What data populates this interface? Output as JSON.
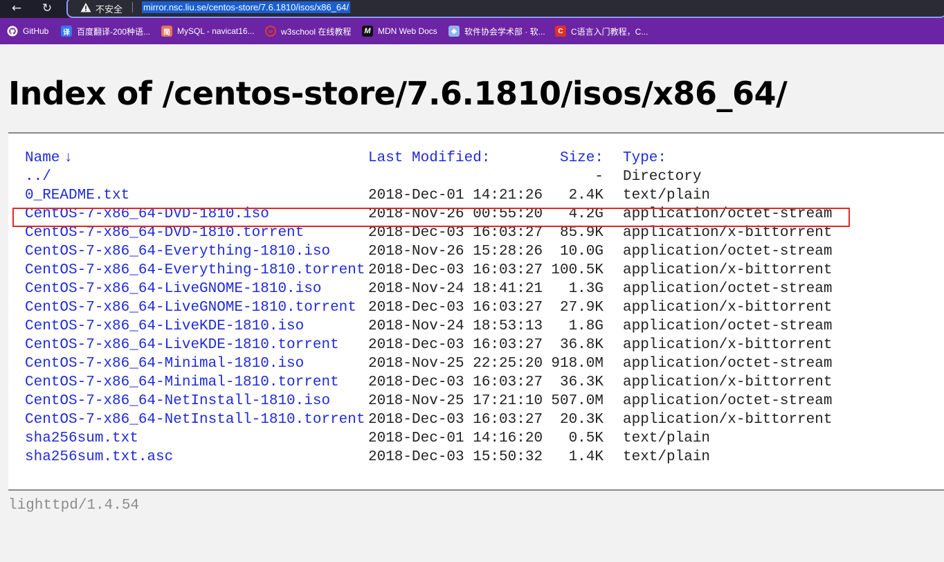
{
  "browser": {
    "security_label": "不安全",
    "url": "mirror.nsc.liu.se/centos-store/7.6.1810/isos/x86_64/",
    "bookmarks": [
      {
        "label": "GitHub",
        "icon": "github-icon"
      },
      {
        "label": "百度翻译-200种语...",
        "icon": "translate-icon"
      },
      {
        "label": "MySQL - navicat16...",
        "icon": "jianshu-icon"
      },
      {
        "label": "w3school 在线教程",
        "icon": "w3school-icon"
      },
      {
        "label": "MDN Web Docs",
        "icon": "mdn-icon"
      },
      {
        "label": "软件协会学术部 · 软...",
        "icon": "bookmark-icon"
      },
      {
        "label": "C语言入门教程，C...",
        "icon": "csdn-icon"
      }
    ]
  },
  "page": {
    "title": "Index of /centos-store/7.6.1810/isos/x86_64/",
    "headers": {
      "name": "Name",
      "sort_arrow": "↓",
      "modified": "Last Modified:",
      "size": "Size:",
      "type": "Type:"
    },
    "rows": [
      {
        "name": "../",
        "modified": "",
        "size": "-",
        "type": "Directory"
      },
      {
        "name": "0_README.txt",
        "modified": "2018-Dec-01 14:21:26",
        "size": "2.4K",
        "type": "text/plain"
      },
      {
        "name": "CentOS-7-x86_64-DVD-1810.iso",
        "modified": "2018-Nov-26 00:55:20",
        "size": "4.2G",
        "type": "application/octet-stream"
      },
      {
        "name": "CentOS-7-x86_64-DVD-1810.torrent",
        "modified": "2018-Dec-03 16:03:27",
        "size": "85.9K",
        "type": "application/x-bittorrent"
      },
      {
        "name": "CentOS-7-x86_64-Everything-1810.iso",
        "modified": "2018-Nov-26 15:28:26",
        "size": "10.0G",
        "type": "application/octet-stream"
      },
      {
        "name": "CentOS-7-x86_64-Everything-1810.torrent",
        "modified": "2018-Dec-03 16:03:27",
        "size": "100.5K",
        "type": "application/x-bittorrent"
      },
      {
        "name": "CentOS-7-x86_64-LiveGNOME-1810.iso",
        "modified": "2018-Nov-24 18:41:21",
        "size": "1.3G",
        "type": "application/octet-stream"
      },
      {
        "name": "CentOS-7-x86_64-LiveGNOME-1810.torrent",
        "modified": "2018-Dec-03 16:03:27",
        "size": "27.9K",
        "type": "application/x-bittorrent"
      },
      {
        "name": "CentOS-7-x86_64-LiveKDE-1810.iso",
        "modified": "2018-Nov-24 18:53:13",
        "size": "1.8G",
        "type": "application/octet-stream"
      },
      {
        "name": "CentOS-7-x86_64-LiveKDE-1810.torrent",
        "modified": "2018-Dec-03 16:03:27",
        "size": "36.8K",
        "type": "application/x-bittorrent"
      },
      {
        "name": "CentOS-7-x86_64-Minimal-1810.iso",
        "modified": "2018-Nov-25 22:25:20",
        "size": "918.0M",
        "type": "application/octet-stream"
      },
      {
        "name": "CentOS-7-x86_64-Minimal-1810.torrent",
        "modified": "2018-Dec-03 16:03:27",
        "size": "36.3K",
        "type": "application/x-bittorrent"
      },
      {
        "name": "CentOS-7-x86_64-NetInstall-1810.iso",
        "modified": "2018-Nov-25 17:21:10",
        "size": "507.0M",
        "type": "application/octet-stream"
      },
      {
        "name": "CentOS-7-x86_64-NetInstall-1810.torrent",
        "modified": "2018-Dec-03 16:03:27",
        "size": "20.3K",
        "type": "application/x-bittorrent"
      },
      {
        "name": "sha256sum.txt",
        "modified": "2018-Dec-01 14:16:20",
        "size": "0.5K",
        "type": "text/plain"
      },
      {
        "name": "sha256sum.txt.asc",
        "modified": "2018-Dec-03 15:50:32",
        "size": "1.4K",
        "type": "text/plain"
      }
    ],
    "footer": "lighttpd/1.4.54"
  },
  "colors": {
    "link": "#1f2bd8",
    "bookmark_bar": "#6b24a3",
    "highlight_box": "#e02828",
    "url_selection": "#1a5fd0"
  }
}
